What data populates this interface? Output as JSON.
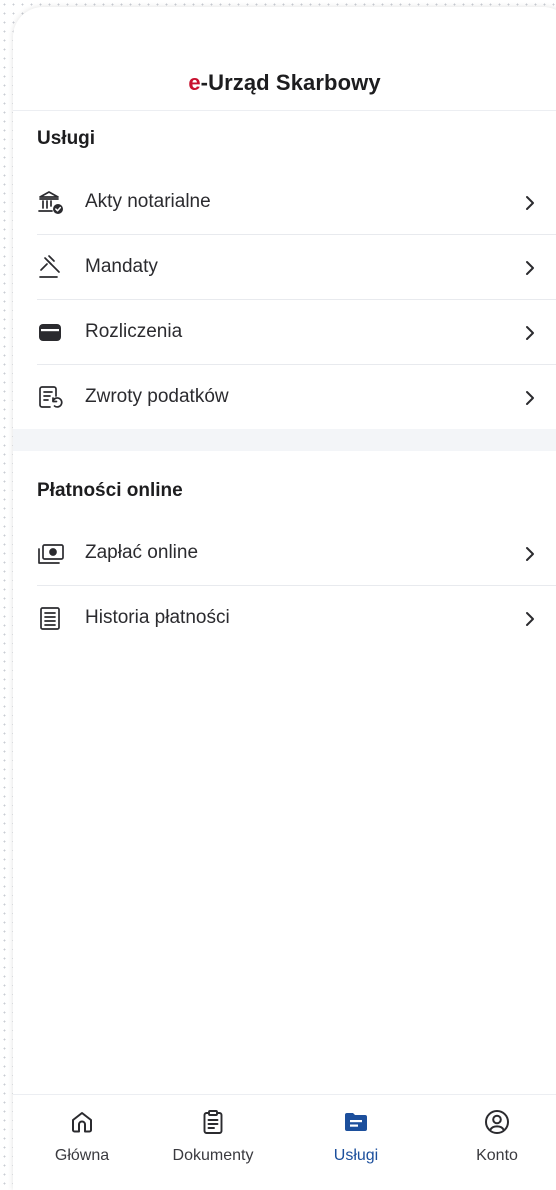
{
  "app": {
    "title_prefix": "e",
    "title_rest": "-Urząd Skarbowy"
  },
  "sections": [
    {
      "title": "Usługi",
      "items": [
        {
          "label": "Akty notarialne",
          "icon": "bank-check-icon"
        },
        {
          "label": "Mandaty",
          "icon": "gavel-icon"
        },
        {
          "label": "Rozliczenia",
          "icon": "wallet-icon"
        },
        {
          "label": "Zwroty podatków",
          "icon": "document-refund-icon"
        }
      ]
    },
    {
      "title": "Płatności online",
      "items": [
        {
          "label": "Zapłać online",
          "icon": "banknote-icon"
        },
        {
          "label": "Historia płatności",
          "icon": "receipt-list-icon"
        }
      ]
    }
  ],
  "tabbar": {
    "tabs": [
      {
        "label": "Główna",
        "icon": "home-icon",
        "active": false
      },
      {
        "label": "Dokumenty",
        "icon": "clipboard-icon",
        "active": false
      },
      {
        "label": "Usługi",
        "icon": "folder-icon",
        "active": true
      },
      {
        "label": "Konto",
        "icon": "user-circle-icon",
        "active": false
      }
    ]
  },
  "colors": {
    "brand_red": "#c8102e",
    "active_blue": "#1c4f9c",
    "text_primary": "#1d1d1f"
  }
}
